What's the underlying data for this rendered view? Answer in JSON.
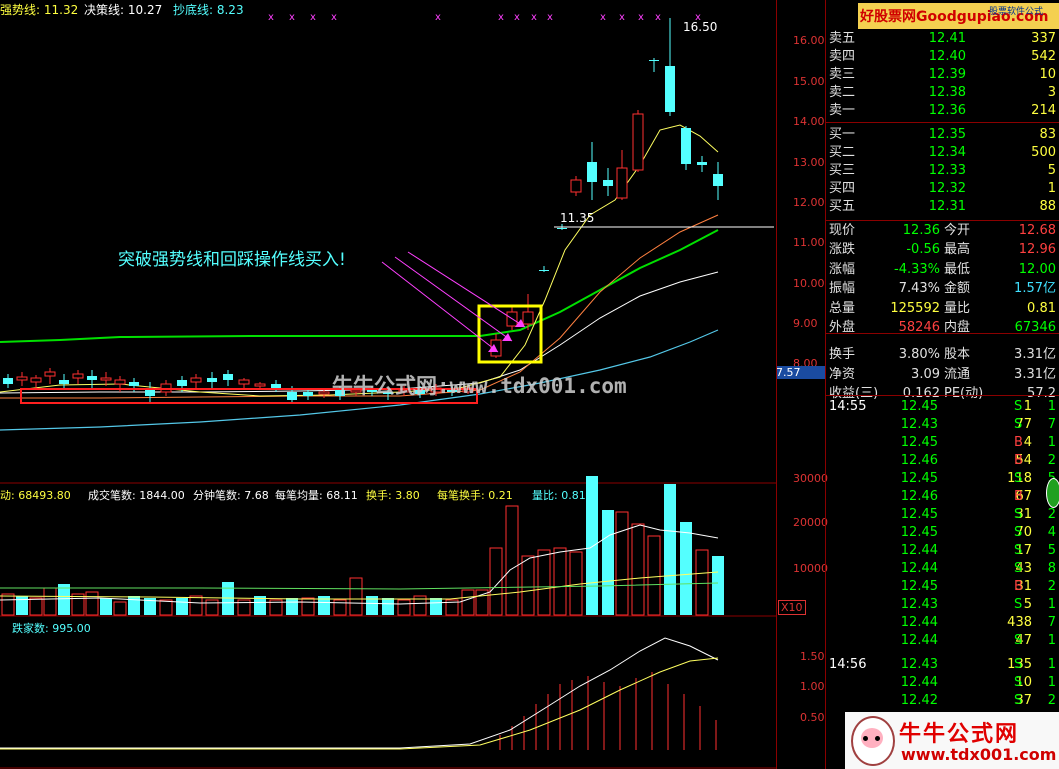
{
  "indicator_header": {
    "strong_line": "强势线: 11.32",
    "decision_line": "决策线: 10.27",
    "bottom_line": "抄底线: 8.23",
    "high_label": "16.50",
    "level_label": "11.35",
    "last_price_tag": "7.57"
  },
  "annotation": {
    "text": "突破强势线和回踩操作线买入!"
  },
  "watermark": {
    "site_text": "牛牛公式网:www.tdx001.com",
    "top_brand": "好股票网Goodgupiao.com",
    "top_brand_sub": "股票软件公式",
    "bottom_brand": "牛牛公式网",
    "bottom_url": "www.tdx001.com",
    "stock_name_partial": "物产中"
  },
  "volume_header": {
    "activity": "动: 68493.80",
    "trade_count": "成交笔数: 1844.00",
    "per_minute": "分钟笔数: 7.68",
    "avg_per_trade": "每笔均量: 68.11",
    "turnover": "换手: 3.80",
    "turnover_per_trade": "每笔换手: 0.21",
    "volume_ratio": "量比: 0.81",
    "scale_tag": "X10"
  },
  "breadth_header": {
    "falling_count": "跌家数: 995.00"
  },
  "price_axis": [
    "16.00",
    "15.00",
    "14.00",
    "13.00",
    "12.00",
    "11.00",
    "10.00",
    "9.00",
    "8.00"
  ],
  "volume_axis": [
    "30000",
    "20000",
    "10000"
  ],
  "breadth_axis": [
    "1.50",
    "1.00",
    "0.50"
  ],
  "order_book": {
    "asks": [
      {
        "label": "卖五",
        "price": "12.41",
        "vol": "337"
      },
      {
        "label": "卖四",
        "price": "12.40",
        "vol": "542"
      },
      {
        "label": "卖三",
        "price": "12.39",
        "vol": "10"
      },
      {
        "label": "卖二",
        "price": "12.38",
        "vol": "3"
      },
      {
        "label": "卖一",
        "price": "12.36",
        "vol": "214"
      }
    ],
    "bids": [
      {
        "label": "买一",
        "price": "12.35",
        "vol": "83"
      },
      {
        "label": "买二",
        "price": "12.34",
        "vol": "500"
      },
      {
        "label": "买三",
        "price": "12.33",
        "vol": "5"
      },
      {
        "label": "买四",
        "price": "12.32",
        "vol": "1"
      },
      {
        "label": "买五",
        "price": "12.31",
        "vol": "88"
      }
    ]
  },
  "quote": [
    {
      "l1": "现价",
      "v1": "12.36",
      "l2": "今开",
      "v2": "12.68",
      "c1": "#00ff00",
      "c2": "#ff4040"
    },
    {
      "l1": "涨跌",
      "v1": "-0.56",
      "l2": "最高",
      "v2": "12.96",
      "c1": "#00ff00",
      "c2": "#ff4040"
    },
    {
      "l1": "涨幅",
      "v1": "-4.33%",
      "l2": "最低",
      "v2": "12.00",
      "c1": "#00ff00",
      "c2": "#00ff00"
    },
    {
      "l1": "振幅",
      "v1": "7.43%",
      "l2": "金额",
      "v2": "1.57亿",
      "c1": "#e0e0e0",
      "c2": "#40e0ff"
    },
    {
      "l1": "总量",
      "v1": "125592",
      "l2": "量比",
      "v2": "0.81",
      "c1": "#ffff40",
      "c2": "#ffff40"
    },
    {
      "l1": "外盘",
      "v1": "58246",
      "l2": "内盘",
      "v2": "67346",
      "c1": "#ff4040",
      "c2": "#00ff00"
    },
    {
      "l1": "换手",
      "v1": "3.80%",
      "l2": "股本",
      "v2": "3.31亿",
      "c1": "#e0e0e0",
      "c2": "#e0e0e0"
    },
    {
      "l1": "净资",
      "v1": "3.09",
      "l2": "流通",
      "v2": "3.31亿",
      "c1": "#e0e0e0",
      "c2": "#e0e0e0"
    },
    {
      "l1": "收益(三)",
      "v1": "0.162",
      "l2": "PE(动)",
      "v2": "57.2",
      "c1": "#e0e0e0",
      "c2": "#e0e0e0"
    }
  ],
  "ticks": [
    {
      "time": "14:55",
      "price": "12.45",
      "vol": "1",
      "side": "S",
      "n": "1"
    },
    {
      "time": "",
      "price": "12.43",
      "vol": "77",
      "side": "S",
      "n": "7"
    },
    {
      "time": "",
      "price": "12.45",
      "vol": "4",
      "side": "B",
      "n": "1"
    },
    {
      "time": "",
      "price": "12.46",
      "vol": "54",
      "side": "B",
      "n": "2"
    },
    {
      "time": "",
      "price": "12.45",
      "vol": "118",
      "side": "S",
      "n": "5"
    },
    {
      "time": "",
      "price": "12.46",
      "vol": "67",
      "side": "B",
      "n": "2"
    },
    {
      "time": "",
      "price": "12.45",
      "vol": "31",
      "side": "S",
      "n": "2"
    },
    {
      "time": "",
      "price": "12.45",
      "vol": "70",
      "side": "S",
      "n": "4"
    },
    {
      "time": "",
      "price": "12.44",
      "vol": "17",
      "side": "S",
      "n": "5"
    },
    {
      "time": "",
      "price": "12.44",
      "vol": "43",
      "side": "S",
      "n": "8"
    },
    {
      "time": "",
      "price": "12.45",
      "vol": "31",
      "side": "B",
      "n": "2"
    },
    {
      "time": "",
      "price": "12.43",
      "vol": "5",
      "side": "S",
      "n": "1"
    },
    {
      "time": "",
      "price": "12.44",
      "vol": "438",
      "side": "",
      "n": "7"
    },
    {
      "time": "",
      "price": "12.44",
      "vol": "47",
      "side": "S",
      "n": "1"
    },
    {
      "time": "14:56",
      "price": "12.43",
      "vol": "135",
      "side": "S",
      "n": "1"
    },
    {
      "time": "",
      "price": "12.44",
      "vol": "10",
      "side": "S",
      "n": "1"
    },
    {
      "time": "",
      "price": "12.42",
      "vol": "37",
      "side": "S",
      "n": "2"
    },
    {
      "time": "",
      "price": "12.43",
      "vol": "1",
      "side": "S",
      "n": "1"
    }
  ],
  "colors": {
    "up": "#ff3030",
    "down": "#54ffff",
    "strong": "#00e000",
    "decision": "#ffffa0",
    "bottom": "#ffffff",
    "fast": "#ff8040",
    "grid": "#8b0000"
  }
}
